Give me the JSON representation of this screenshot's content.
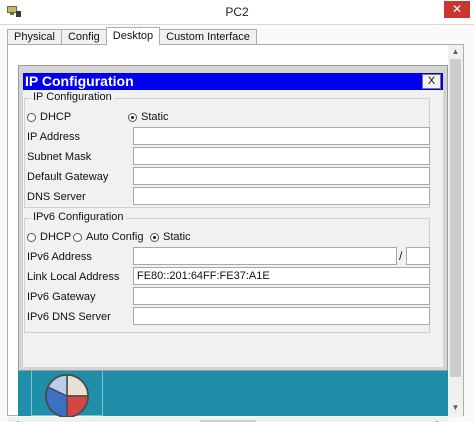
{
  "window": {
    "title": "PC2",
    "close_glyph": "✕",
    "icon": "pc-icon"
  },
  "tabs": [
    {
      "label": "Physical"
    },
    {
      "label": "Config"
    },
    {
      "label": "Desktop",
      "active": true
    },
    {
      "label": "Custom Interface"
    }
  ],
  "dialog": {
    "title": "IP Configuration",
    "close_label": "X",
    "header_color": "#0000ee",
    "ipv4": {
      "group_title": "IP Configuration",
      "mode_options": [
        "DHCP",
        "Static"
      ],
      "selected_mode": "Static",
      "fields": [
        {
          "label": "IP Address",
          "value": ""
        },
        {
          "label": "Subnet Mask",
          "value": ""
        },
        {
          "label": "Default Gateway",
          "value": ""
        },
        {
          "label": "DNS Server",
          "value": ""
        }
      ]
    },
    "ipv6": {
      "group_title": "IPv6 Configuration",
      "mode_options": [
        "DHCP",
        "Auto Config",
        "Static"
      ],
      "selected_mode": "Static",
      "fields": [
        {
          "label": "IPv6 Address",
          "value": "",
          "prefix_separator": "/",
          "prefix_value": ""
        },
        {
          "label": "Link Local Address",
          "value": "FE80::201:64FF:FE37:A1E"
        },
        {
          "label": "IPv6 Gateway",
          "value": ""
        },
        {
          "label": "IPv6 DNS Server",
          "value": ""
        }
      ]
    }
  },
  "desktop": {
    "background_color": "#1f8fa9",
    "app_icon": "ip-configuration-pie-icon"
  },
  "scrollbars": {
    "up": "▲",
    "down": "▼",
    "left": "◀",
    "right": "▶"
  }
}
